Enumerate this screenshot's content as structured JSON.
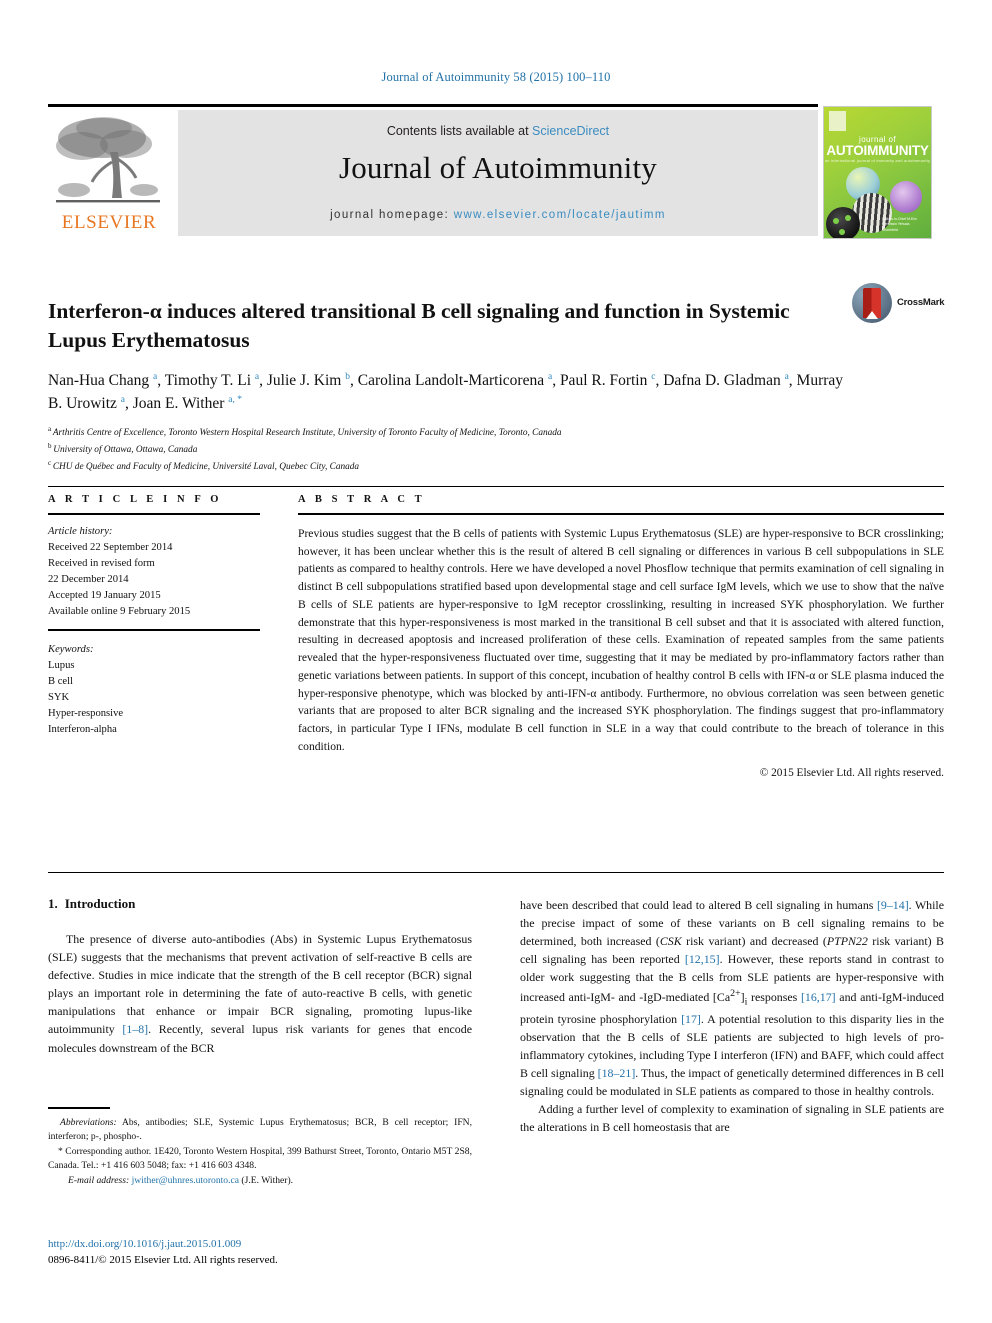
{
  "running_head": "Journal of Autoimmunity 58 (2015) 100–110",
  "masthead": {
    "contents_prefix": "Contents lists available at ",
    "sciencedirect": "ScienceDirect",
    "journal_name": "Journal of Autoimmunity",
    "homepage_prefix": "journal homepage: ",
    "homepage_url": "www.elsevier.com/locate/jautimm",
    "publisher": "ELSEVIER",
    "cover": {
      "journal_of": "journal of",
      "title": "AUTOIMMUNITY",
      "subtitle": "an international journal of immunity and autoimmunity",
      "footer": "Editors-in-Chief M.Eric Gershwin Yehuda Shoenfeld"
    },
    "link_color": "#3a8cc1"
  },
  "article": {
    "title": "Interferon-α induces altered transitional B cell signaling and function in Systemic Lupus Erythematosus",
    "crossmark_label": "CrossMark",
    "authors": [
      {
        "name": "Nan-Hua Chang",
        "marks": "a",
        "sep": ", "
      },
      {
        "name": "Timothy T. Li",
        "marks": "a",
        "sep": ", "
      },
      {
        "name": "Julie J. Kim",
        "marks": "b",
        "sep": ", "
      },
      {
        "name": "Carolina Landolt-Marticorena",
        "marks": "a",
        "sep": ", "
      },
      {
        "name": "Paul R. Fortin",
        "marks": "c",
        "sep": ", "
      },
      {
        "name": "Dafna D. Gladman",
        "marks": "a",
        "sep": ", "
      },
      {
        "name": "Murray B. Urowitz",
        "marks": "a",
        "sep": ", "
      },
      {
        "name": "Joan E. Wither",
        "marks": "a, *",
        "sep": ""
      }
    ],
    "affiliations": [
      {
        "mark": "a",
        "text": "Arthritis Centre of Excellence, Toronto Western Hospital Research Institute, University of Toronto Faculty of Medicine, Toronto, Canada"
      },
      {
        "mark": "b",
        "text": "University of Ottawa, Ottawa, Canada"
      },
      {
        "mark": "c",
        "text": "CHU de Québec and Faculty of Medicine, Université Laval, Quebec City, Canada"
      }
    ]
  },
  "article_info": {
    "heading": "A R T I C L E   I N F O",
    "history_label": "Article history:",
    "history": [
      "Received 22 September 2014",
      "Received in revised form",
      "22 December 2014",
      "Accepted 19 January 2015",
      "Available online 9 February 2015"
    ],
    "keywords_label": "Keywords:",
    "keywords": [
      "Lupus",
      "B cell",
      "SYK",
      "Hyper-responsive",
      "Interferon-alpha"
    ]
  },
  "abstract": {
    "heading": "A B S T R A C T",
    "text": "Previous studies suggest that the B cells of patients with Systemic Lupus Erythematosus (SLE) are hyper-responsive to BCR crosslinking; however, it has been unclear whether this is the result of altered B cell signaling or differences in various B cell subpopulations in SLE patients as compared to healthy controls. Here we have developed a novel Phosflow technique that permits examination of cell signaling in distinct B cell subpopulations stratified based upon developmental stage and cell surface IgM levels, which we use to show that the naïve B cells of SLE patients are hyper-responsive to IgM receptor crosslinking, resulting in increased SYK phosphorylation. We further demonstrate that this hyper-responsiveness is most marked in the transitional B cell subset and that it is associated with altered function, resulting in decreased apoptosis and increased proliferation of these cells. Examination of repeated samples from the same patients revealed that the hyper-responsiveness fluctuated over time, suggesting that it may be mediated by pro-inflammatory factors rather than genetic variations between patients. In support of this concept, incubation of healthy control B cells with IFN-α or SLE plasma induced the hyper-responsive phenotype, which was blocked by anti-IFN-α antibody. Furthermore, no obvious correlation was seen between genetic variants that are proposed to alter BCR signaling and the increased SYK phosphorylation. The findings suggest that pro-inflammatory factors, in particular Type I IFNs, modulate B cell function in SLE in a way that could contribute to the breach of tolerance in this condition.",
    "copyright": "© 2015 Elsevier Ltd. All rights reserved."
  },
  "body": {
    "section_number": "1.",
    "section_title": "Introduction",
    "left_paragraph_parts": [
      "The presence of diverse auto-antibodies (Abs) in Systemic Lupus Erythematosus (SLE) suggests that the mechanisms that prevent activation of self-reactive B cells are defective. Studies in mice indicate that the strength of the B cell receptor (BCR) signal plays an important role in determining the fate of auto-reactive B cells, with genetic manipulations that enhance or impair BCR signaling, promoting lupus-like autoimmunity ",
      "[1–8]",
      ". Recently, several lupus risk variants for genes that encode molecules downstream of the BCR"
    ],
    "right_paragraph_parts": [
      "have been described that could lead to altered B cell signaling in humans ",
      "[9–14]",
      ". While the precise impact of some of these variants on B cell signaling remains to be determined, both increased (",
      "CSK",
      " risk variant) and decreased (",
      "PTPN22",
      " risk variant) B cell signaling has been reported ",
      "[12,15]",
      ". However, these reports stand in contrast to older work suggesting that the B cells from SLE patients are hyper-responsive with increased anti-IgM- and -IgD-mediated [Ca",
      "2+",
      "]",
      "i",
      " responses ",
      "[16,17]",
      " and anti-IgM-induced protein tyrosine phosphorylation ",
      "[17]",
      ". A potential resolution to this disparity lies in the observation that the B cells of SLE patients are subjected to high levels of pro-inflammatory cytokines, including Type I interferon (IFN) and BAFF, which could affect B cell signaling ",
      "[18–21]",
      ". Thus, the impact of genetically determined differences in B cell signaling could be modulated in SLE patients as compared to those in healthy controls."
    ],
    "right_paragraph_2": "Adding a further level of complexity to examination of signaling in SLE patients are the alterations in B cell homeostasis that are"
  },
  "footnote": {
    "abbreviations_label": "Abbreviations:",
    "abbreviations_text": " Abs, antibodies; SLE, Systemic Lupus Erythematosus; BCR, B cell receptor; IFN, interferon; p-, phospho-.",
    "corresponding_marker": "*",
    "corresponding_text": " Corresponding author. 1E420, Toronto Western Hospital, 399 Bathurst Street, Toronto, Ontario M5T 2S8, Canada. Tel.: +1 416 603 5048; fax: +1 416 603 4348.",
    "email_label": "E-mail address:",
    "email": "jwither@uhnres.utoronto.ca",
    "email_owner": " (J.E. Wither)."
  },
  "publication": {
    "doi": "http://dx.doi.org/10.1016/j.jaut.2015.01.009",
    "issn_line": "0896-8411/© 2015 Elsevier Ltd. All rights reserved."
  }
}
